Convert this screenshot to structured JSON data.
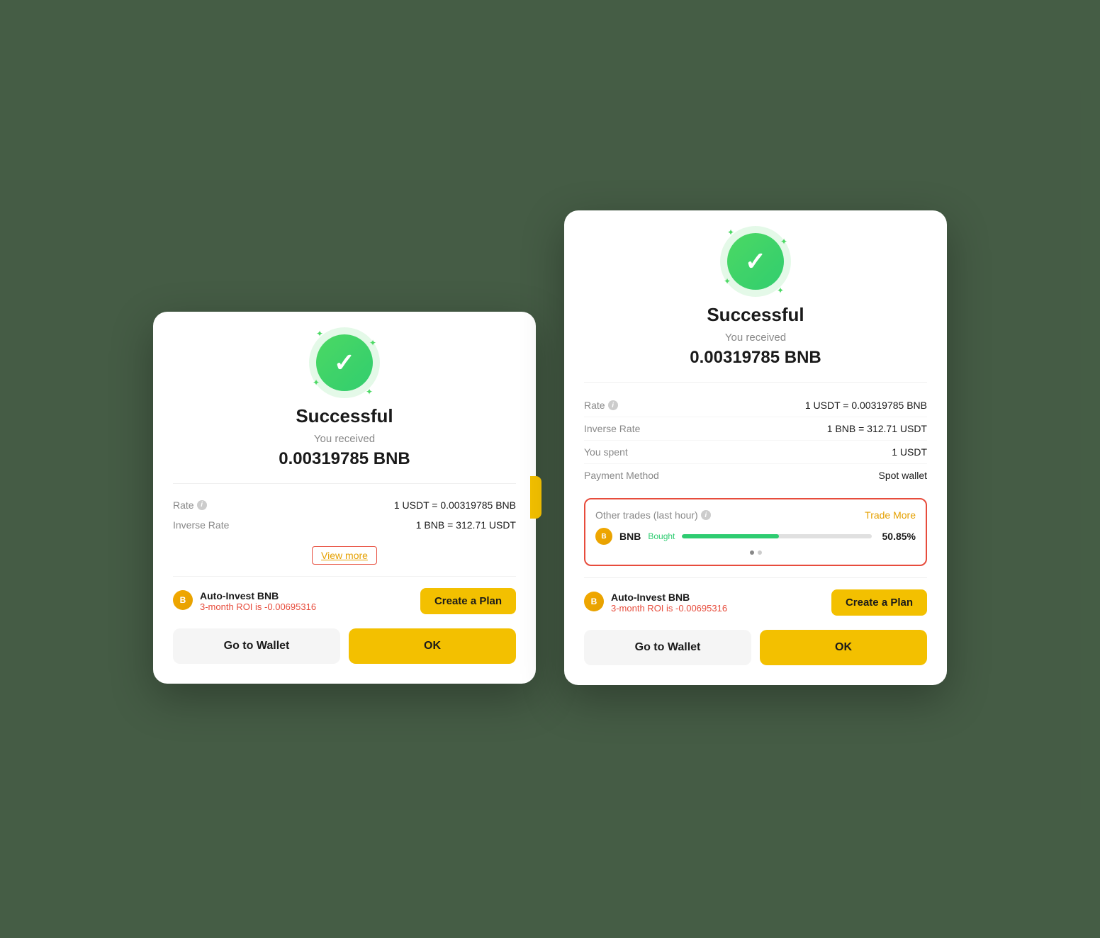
{
  "dialogs": {
    "left": {
      "title": "Successful",
      "subtitle": "You received",
      "amount": "0.00319785 BNB",
      "rate_label": "Rate",
      "rate_value": "1 USDT = 0.00319785 BNB",
      "inverse_rate_label": "Inverse Rate",
      "inverse_rate_value": "1 BNB = 312.71 USDT",
      "view_more_label": "View more",
      "auto_invest_title": "Auto-Invest BNB",
      "auto_invest_roi_prefix": "3-month ROI is",
      "auto_invest_roi_value": "-0.00695316",
      "create_plan_label": "Create a Plan",
      "go_to_wallet_label": "Go to Wallet",
      "ok_label": "OK"
    },
    "right": {
      "title": "Successful",
      "subtitle": "You received",
      "amount": "0.00319785 BNB",
      "rate_label": "Rate",
      "rate_value": "1 USDT = 0.00319785 BNB",
      "inverse_rate_label": "Inverse Rate",
      "inverse_rate_value": "1 BNB = 312.71 USDT",
      "you_spent_label": "You spent",
      "you_spent_value": "1 USDT",
      "payment_method_label": "Payment Method",
      "payment_method_value": "Spot wallet",
      "other_trades_title": "Other trades (last hour)",
      "trade_more_label": "Trade More",
      "trade_coin": "BNB",
      "trade_action": "Bought",
      "trade_percent": "50.85%",
      "trade_progress": 51,
      "auto_invest_title": "Auto-Invest BNB",
      "auto_invest_roi_prefix": "3-month ROI is",
      "auto_invest_roi_value": "-0.00695316",
      "create_plan_label": "Create a Plan",
      "go_to_wallet_label": "Go to Wallet",
      "ok_label": "OK"
    }
  }
}
